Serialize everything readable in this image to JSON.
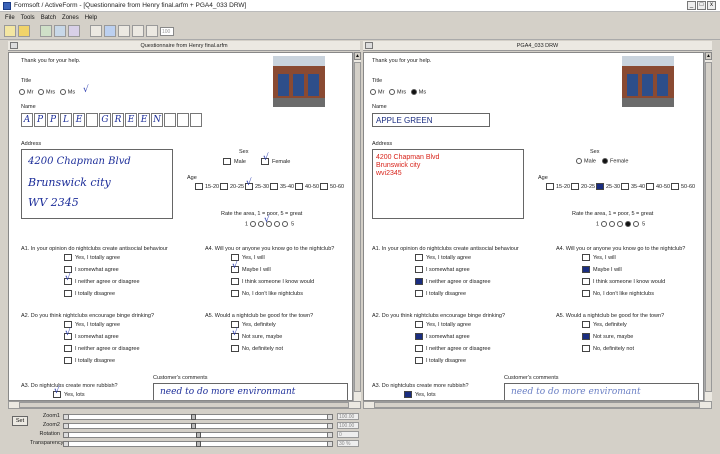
{
  "window": {
    "title": "Formsoft / ActiveForm - [Questionnaire from Henry final.arfm + PGA4_033 DRW]",
    "controls": [
      "_",
      "□",
      "x"
    ]
  },
  "menu": [
    "File",
    "Tools",
    "Batch",
    "Zones",
    "Help"
  ],
  "toolbar": {
    "zoom_field": "100"
  },
  "left_pane": {
    "header": "Questionnaire from Henry final.arfm"
  },
  "right_pane": {
    "header": "PGA4_033 DRW"
  },
  "form": {
    "thanks": "Thank you for your help.",
    "title_label": "Title",
    "title_options": [
      "Mr",
      "Mrs",
      "Ms"
    ],
    "name_label": "Name",
    "name_chars": [
      "A",
      "P",
      "P",
      "L",
      "E",
      "",
      "G",
      "R",
      "E",
      "E",
      "N"
    ],
    "name_value": "APPLE GREEN",
    "address_label": "Address",
    "address_hand": [
      "4200 Chapman Blvd",
      "Brunswick city",
      "WV 2345"
    ],
    "address_typed": [
      "4200 Chapman Blvd",
      "Brunswick city",
      "wvi2345"
    ],
    "sex_label": "Sex",
    "sex_options": [
      "Male",
      "Female"
    ],
    "age_label": "Age",
    "age_options": [
      "15-20",
      "20-25",
      "25-30",
      "35-40",
      "40-50",
      "50-60"
    ],
    "rate_label": "Rate the area, 1 = poor, 5 = great",
    "rate_values": [
      "1",
      "5"
    ],
    "q_a1": "A1. In your opinion do nightclubs create antisocial behaviour",
    "a1_options": [
      "Yes, I totally agree",
      "I somewhat agree",
      "I neither agree or disagree",
      "I totally disagree"
    ],
    "q_a4": "A4. Will you or anyone you know go to the nightclub?",
    "a4_options": [
      "Yes, I will",
      "Maybe I will",
      "I think someone I know would",
      "No, I don't like nightclubs"
    ],
    "q_a2": "A2. Do you think nightclubs encourage  binge drinking?",
    "a2_options": [
      "Yes, I totally agree",
      "I somewhat agree",
      "I neither agree or disagree",
      "I totally disagree"
    ],
    "q_a5": "A5. Would a nightclub be good for the town?",
    "a5_options": [
      "Yes, definitely",
      "Not sure, maybe",
      "No, definitely not"
    ],
    "comments_label": "Customer's comments",
    "comments_hand": "need to do more environmant",
    "comments_typed": "need to do more enviromant",
    "q_a3": "A3. Do nightclubs create more rubbish?",
    "a3_options": [
      "Yes, lots"
    ]
  },
  "bottom": {
    "button": "Set",
    "sliders": [
      {
        "label": "Zoom1",
        "value": "100.00",
        "position": 0.48
      },
      {
        "label": "Zoom2",
        "value": "100.00",
        "position": 0.48
      },
      {
        "label": "Rotation",
        "value": "0",
        "position": 0.5
      },
      {
        "label": "Transparency",
        "value": "30 %",
        "position": 0.5
      }
    ]
  },
  "colors": {
    "pen": "#1e2f9a",
    "typed": "#1a2d80",
    "address_red": "#d8231a"
  }
}
